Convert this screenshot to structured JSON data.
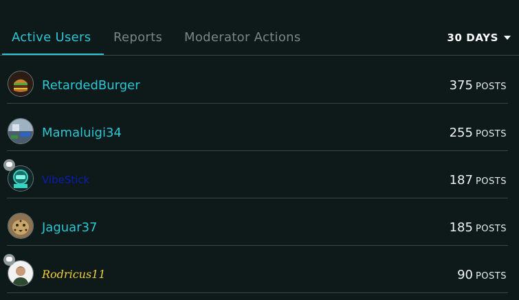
{
  "tabs": [
    {
      "label": "Active Users",
      "active": true
    },
    {
      "label": "Reports",
      "active": false
    },
    {
      "label": "Moderator Actions",
      "active": false
    }
  ],
  "range": {
    "label": "30 DAYS"
  },
  "colors": {
    "accent": "#2cc6d4",
    "background": "#0e1a1a",
    "inactive_tab": "#7b8686",
    "divider": "#3a4646"
  },
  "users": [
    {
      "name": "RetardedBurger",
      "posts": "375",
      "posts_label": "POSTS",
      "avatar": "burger-avatar",
      "badge": false
    },
    {
      "name": "Mamaluigi34",
      "posts": "255",
      "posts_label": "POSTS",
      "avatar": "scene-avatar",
      "badge": false
    },
    {
      "name": "VibeStick",
      "posts": "187",
      "posts_label": "POSTS",
      "avatar": "robot-avatar",
      "badge": true
    },
    {
      "name": "Jaguar37",
      "posts": "185",
      "posts_label": "POSTS",
      "avatar": "jaguar-avatar",
      "badge": false
    },
    {
      "name": "Rodricus11",
      "posts": "90",
      "posts_label": "POSTS",
      "avatar": "person-avatar",
      "badge": true
    }
  ]
}
